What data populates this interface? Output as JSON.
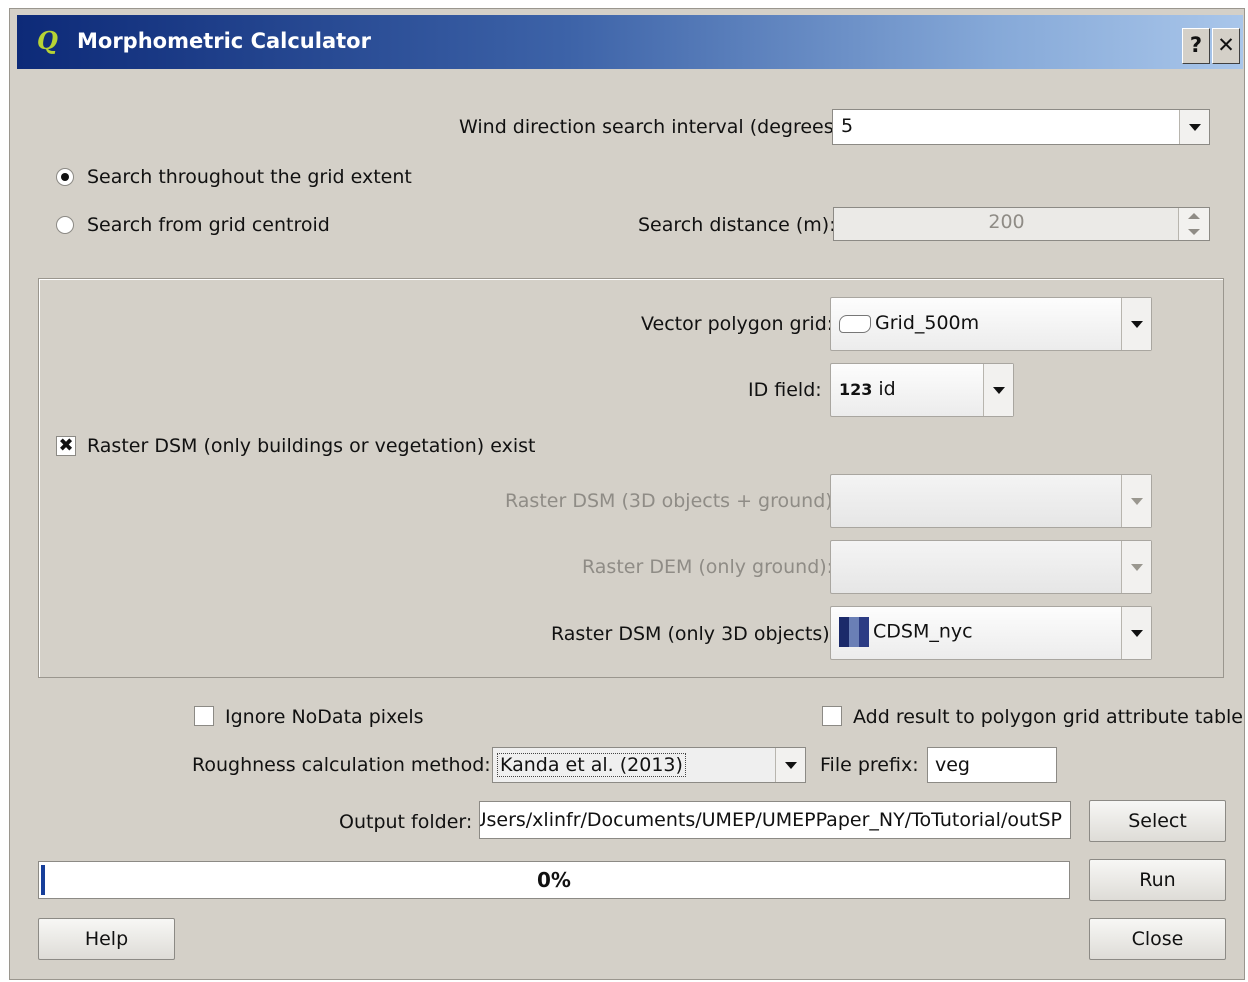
{
  "window": {
    "title": "Morphometric Calculator",
    "help_glyph": "?",
    "close_glyph": "✕"
  },
  "wind": {
    "label": "Wind direction search interval (degrees):",
    "value": "5"
  },
  "search": {
    "option_extent": "Search throughout the grid extent",
    "option_centroid": "Search from grid centroid",
    "selected": "extent",
    "distance_label": "Search distance (m):",
    "distance_value": "200"
  },
  "inputs": {
    "vector_label": "Vector polygon grid:",
    "vector_value": "Grid_500m",
    "id_label": "ID field:",
    "id_type": "123",
    "id_value": "id",
    "raster_exist_label": "Raster DSM (only buildings or vegetation) exist",
    "raster_exist_checked": true,
    "dsm_label": "Raster DSM (3D objects + ground):",
    "dsm_value": "",
    "dem_label": "Raster DEM (only ground):",
    "dem_value": "",
    "cdsm_label": "Raster DSM (only 3D objects):",
    "cdsm_value": "CDSM_nyc"
  },
  "options": {
    "ignore_nodata_label": "Ignore NoData pixels",
    "ignore_nodata_checked": false,
    "add_result_label": "Add result to polygon grid attribute table",
    "add_result_checked": false,
    "roughness_label": "Roughness calculation method:",
    "roughness_value": "Kanda et al. (2013)",
    "prefix_label": "File prefix:",
    "prefix_value": "veg",
    "output_label": "Output folder:",
    "output_value": "C:/Users/xlinfr/Documents/UMEP/UMEPPaper_NY/ToTutorial/outSP"
  },
  "progress": {
    "value": 0,
    "label": "0%"
  },
  "buttons": {
    "select": "Select",
    "run": "Run",
    "help": "Help",
    "close": "Close"
  },
  "colors": {
    "title_start": "#0d2a78",
    "title_end": "#a9c6ea",
    "progress_fill": "#173f9a",
    "dialog_bg": "#d4d0c8"
  }
}
